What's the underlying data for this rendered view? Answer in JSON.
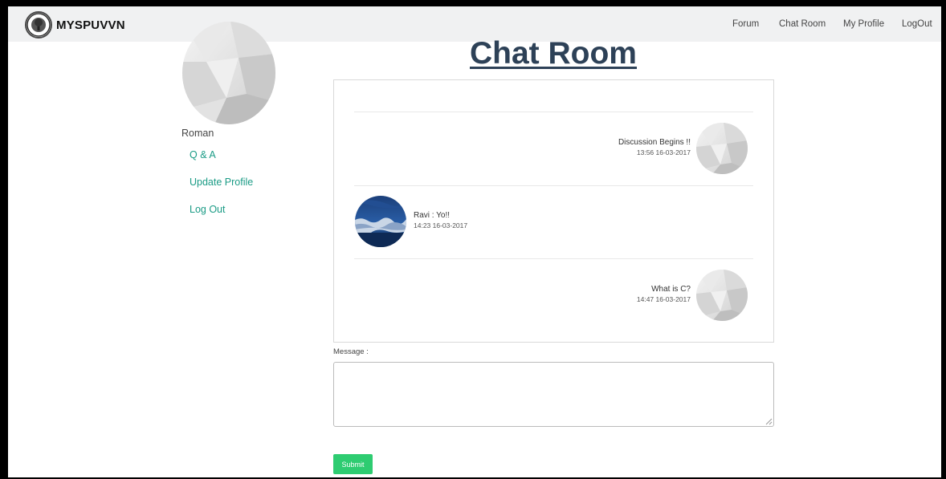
{
  "navbar": {
    "brand": "MYSPUVVN",
    "links": [
      {
        "label": "Forum"
      },
      {
        "label": "Chat Room"
      },
      {
        "label": "My Profile"
      },
      {
        "label": "LogOut"
      }
    ]
  },
  "sidebar": {
    "user_name": "Roman",
    "links": [
      {
        "label": "Q & A"
      },
      {
        "label": "Update Profile"
      },
      {
        "label": "Log Out"
      }
    ]
  },
  "page": {
    "title": "Chat Room"
  },
  "chat": {
    "messages": [
      {
        "side": "right",
        "text": "Discussion Begins !!",
        "time": "13:56 16-03-2017",
        "avatar": "default-avatar"
      },
      {
        "side": "left",
        "text": "Ravi : Yo!!",
        "time": "14:23 16-03-2017",
        "avatar": "blue-landscape-avatar"
      },
      {
        "side": "right",
        "text": "What is C?",
        "time": "14:47 16-03-2017",
        "avatar": "default-avatar"
      }
    ]
  },
  "form": {
    "message_label": "Message :",
    "message_value": "",
    "submit_label": "Submit"
  },
  "colors": {
    "link": "#1a9b85",
    "title": "#2d4157",
    "submit": "#2ecc71",
    "navbar_bg": "#f0f1f2"
  }
}
